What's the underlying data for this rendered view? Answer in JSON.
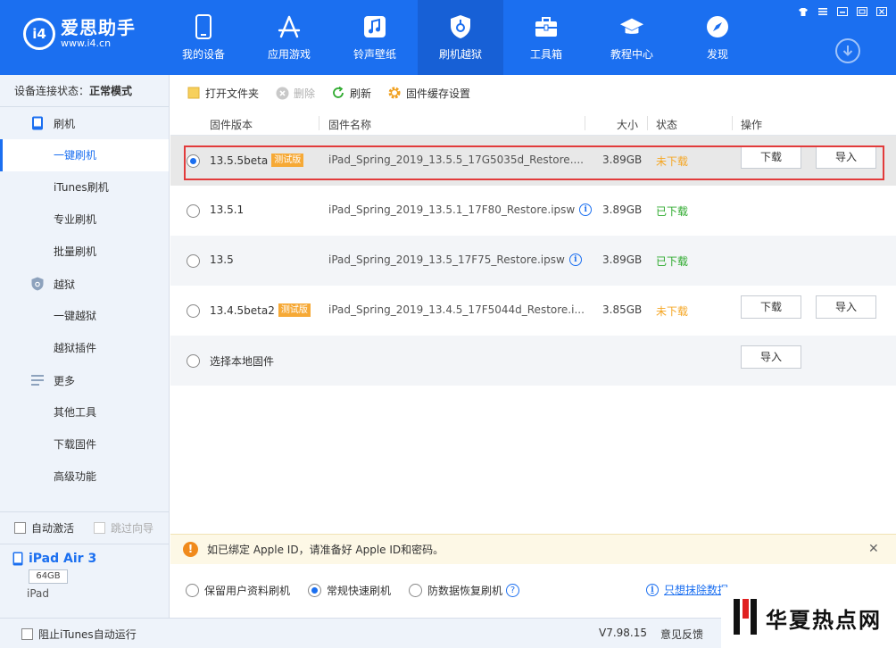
{
  "app": {
    "logo_badge": "i4",
    "name": "爱思助手",
    "url": "www.i4.cn"
  },
  "nav": [
    {
      "label": "我的设备",
      "icon": "phone-icon"
    },
    {
      "label": "应用游戏",
      "icon": "app-store-icon"
    },
    {
      "label": "铃声壁纸",
      "icon": "music-icon"
    },
    {
      "label": "刷机越狱",
      "icon": "shield-icon",
      "active": true
    },
    {
      "label": "工具箱",
      "icon": "toolbox-icon"
    },
    {
      "label": "教程中心",
      "icon": "graduation-cap-icon"
    },
    {
      "label": "发现",
      "icon": "compass-icon"
    }
  ],
  "window_controls": [
    "shirt-icon",
    "menu-icon",
    "minimize-icon",
    "maximize-icon",
    "close-icon"
  ],
  "sidebar": {
    "conn_label": "设备连接状态：",
    "conn_value": "正常模式",
    "groups": [
      {
        "label": "刷机",
        "icon": "phone-icon",
        "items": [
          "一键刷机",
          "iTunes刷机",
          "专业刷机",
          "批量刷机"
        ]
      },
      {
        "label": "越狱",
        "icon": "shield-icon",
        "items": [
          "一键越狱",
          "越狱插件"
        ]
      },
      {
        "label": "更多",
        "icon": "menu-icon",
        "items": [
          "其他工具",
          "下载固件",
          "高级功能"
        ]
      }
    ],
    "active_item": "一键刷机",
    "auto_activate": "自动激活",
    "skip_guide": "跳过向导",
    "device_name": "iPad Air 3",
    "device_capacity": "64GB",
    "device_type": "iPad"
  },
  "toolbar": {
    "open_folder": "打开文件夹",
    "delete": "删除",
    "refresh": "刷新",
    "cache_settings": "固件缓存设置"
  },
  "table": {
    "headers": {
      "version": "固件版本",
      "name": "固件名称",
      "size": "大小",
      "status": "状态",
      "action": "操作"
    },
    "beta_badge": "测试版",
    "rows": [
      {
        "version": "13.5.5beta",
        "beta": true,
        "name": "iPad_Spring_2019_13.5.5_17G5035d_Restore....",
        "size": "3.89GB",
        "status": "未下载",
        "downloaded": false,
        "download": "下载",
        "import": "导入",
        "selected": true
      },
      {
        "version": "13.5.1",
        "beta": false,
        "name": "iPad_Spring_2019_13.5.1_17F80_Restore.ipsw",
        "size": "3.89GB",
        "status": "已下载",
        "downloaded": true
      },
      {
        "version": "13.5",
        "beta": false,
        "name": "iPad_Spring_2019_13.5_17F75_Restore.ipsw",
        "size": "3.89GB",
        "status": "已下载",
        "downloaded": true
      },
      {
        "version": "13.4.5beta2",
        "beta": true,
        "name": "iPad_Spring_2019_13.4.5_17F5044d_Restore.i...",
        "size": "3.85GB",
        "status": "未下载",
        "downloaded": false,
        "download": "下载",
        "import": "导入"
      }
    ],
    "local_label": "选择本地固件",
    "local_import": "导入"
  },
  "notice": {
    "text": "如已绑定 Apple ID，请准备好 Apple ID和密码。"
  },
  "modes": {
    "keep_data": "保留用户资料刷机",
    "quick": "常规快速刷机",
    "anti_recovery": "防数据恢复刷机",
    "erase_link": "只想抹除数据"
  },
  "statusbar": {
    "block_itunes": "阻止iTunes自动运行",
    "version": "V7.98.15",
    "feedback": "意见反馈"
  },
  "watermark": {
    "text": "华夏热点网"
  },
  "colors": {
    "brand_blue": "#1b6ff0",
    "warning_orange": "#f5a623",
    "success_green": "#2eaa2e",
    "highlight_red": "#e23b3b"
  }
}
